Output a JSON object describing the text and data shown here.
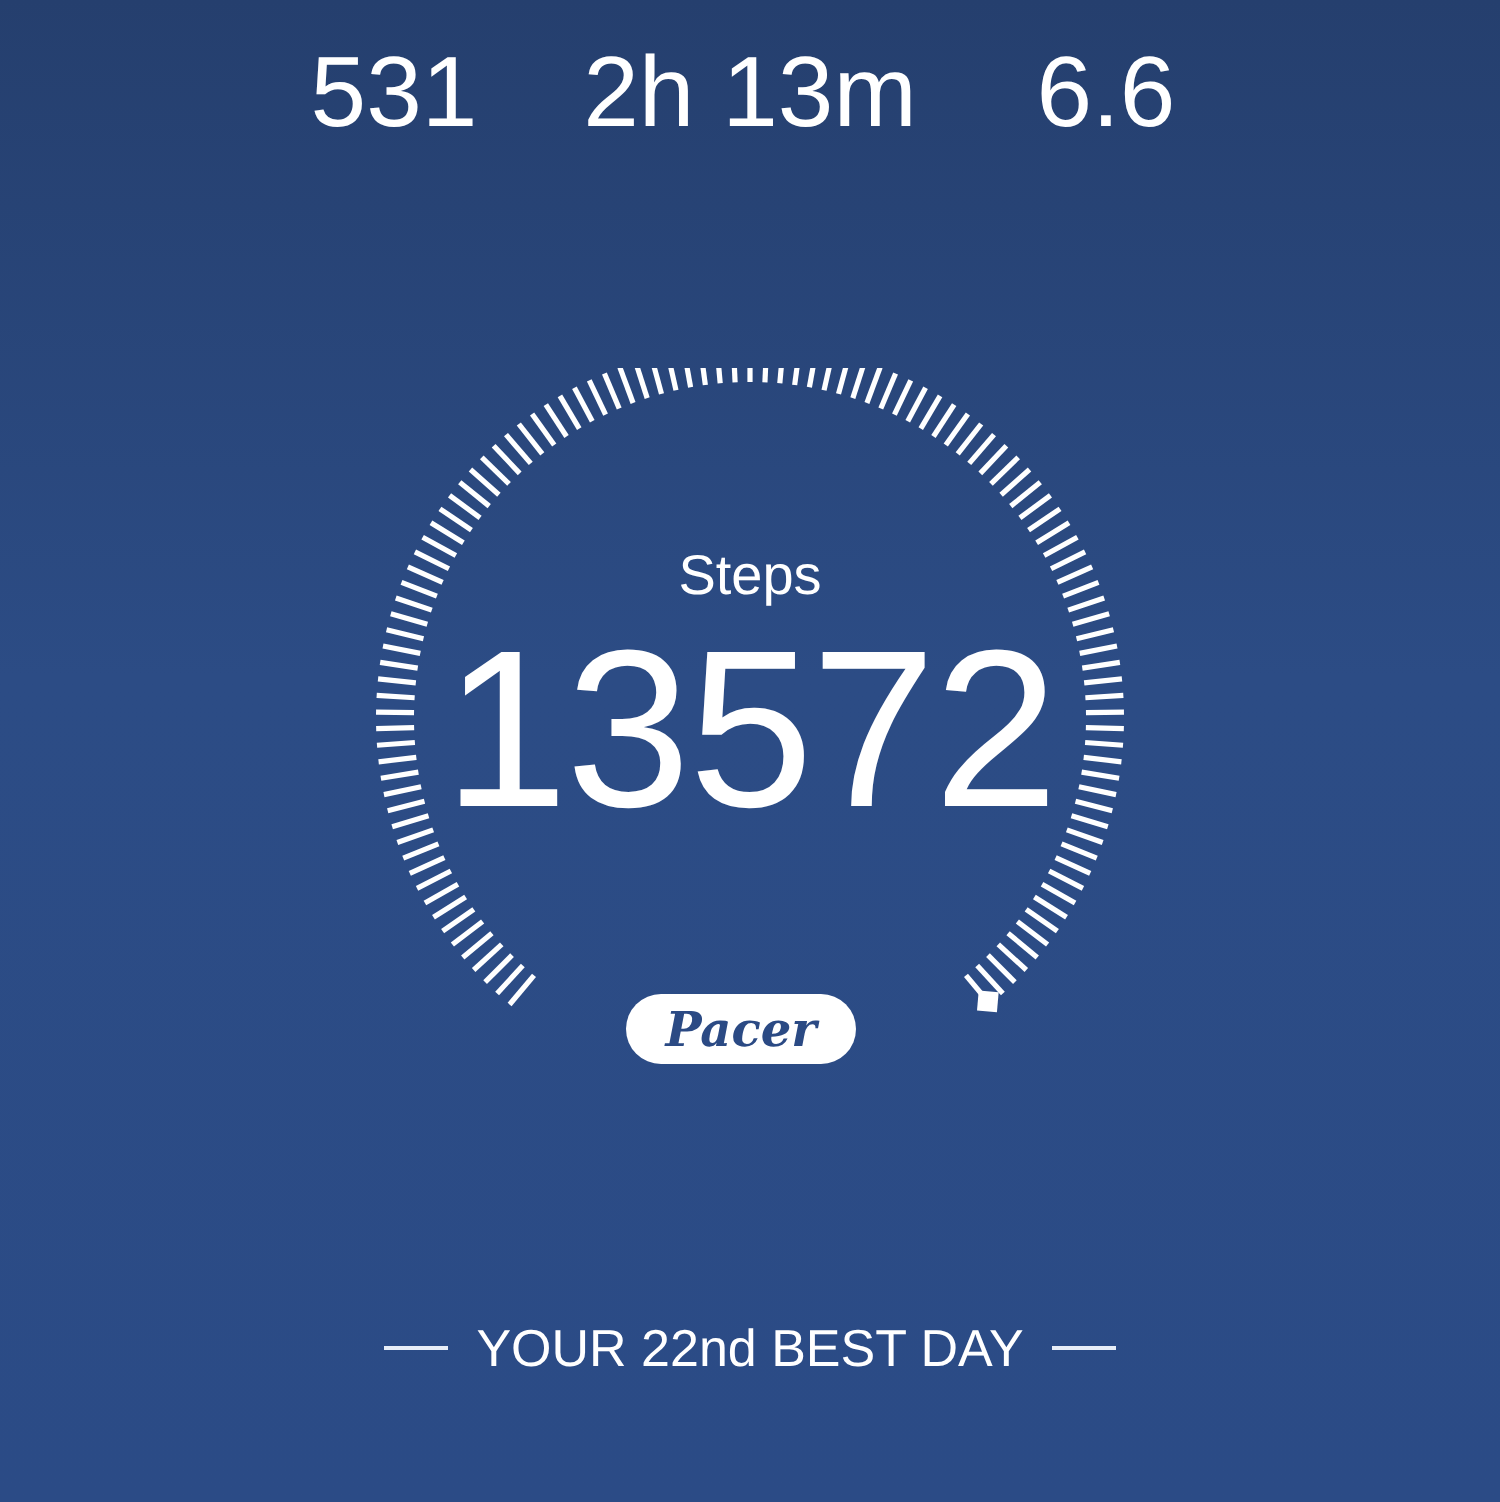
{
  "stats": [
    {
      "value": "531"
    },
    {
      "value": "2h 13m"
    },
    {
      "value": "6.6"
    }
  ],
  "gauge": {
    "label": "Steps",
    "value": "13572"
  },
  "logo": {
    "text": "Pacer"
  },
  "rank": "YOUR 22nd BEST DAY"
}
